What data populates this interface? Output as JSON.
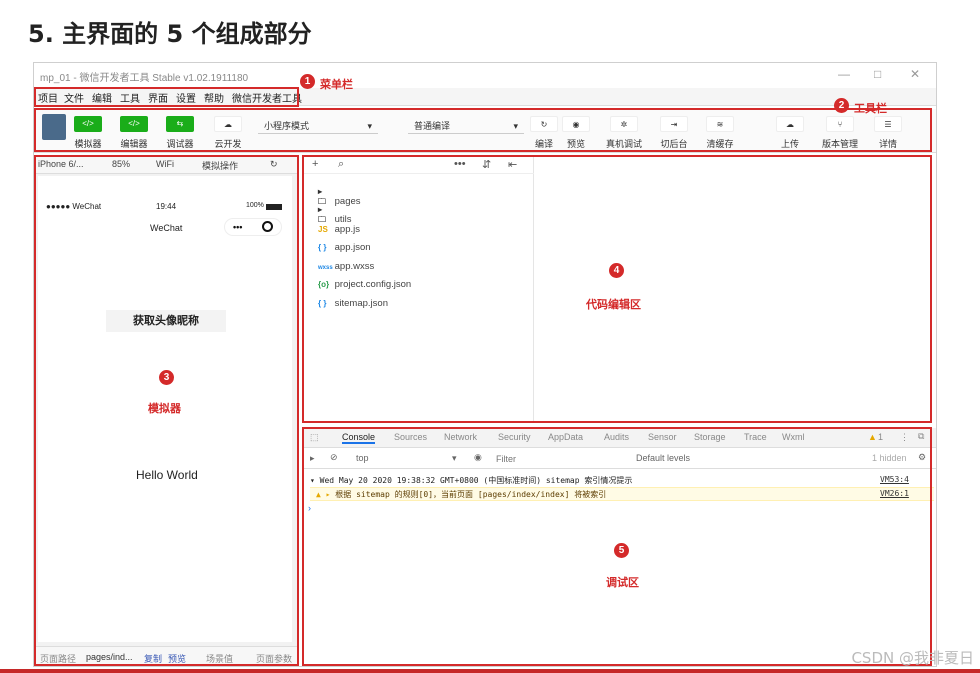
{
  "heading": "5. 主界面的 5 个组成部分",
  "window": {
    "title": "mp_01 - 微信开发者工具 Stable v1.02.1911180",
    "controls": [
      "—",
      "□",
      "✕"
    ]
  },
  "menu": [
    "项目",
    "文件",
    "编辑",
    "工具",
    "界面",
    "设置",
    "帮助",
    "微信开发者工具"
  ],
  "annotations": [
    {
      "num": "1",
      "label": "菜单栏"
    },
    {
      "num": "2",
      "label": "工具栏"
    },
    {
      "num": "3",
      "label": "模拟器"
    },
    {
      "num": "4",
      "label": "代码编辑区"
    },
    {
      "num": "5",
      "label": "调试区"
    }
  ],
  "toolbar": {
    "left_buttons": [
      {
        "icon": "</>",
        "label": "模拟器"
      },
      {
        "icon": "</>",
        "label": "编辑器"
      },
      {
        "icon": "⇆",
        "label": "调试器"
      },
      {
        "icon": "☁",
        "label": "云开发"
      }
    ],
    "mode_select": "小程序模式",
    "compile_select": "普通编译",
    "right_buttons": [
      {
        "icon": "↻",
        "label": "编译"
      },
      {
        "icon": "◉",
        "label": "预览"
      },
      {
        "icon": "✲",
        "label": "真机调试"
      },
      {
        "icon": "⇥",
        "label": "切后台"
      },
      {
        "icon": "≋",
        "label": "清缓存"
      },
      {
        "icon": "☁",
        "label": "上传"
      },
      {
        "icon": "⑂",
        "label": "版本管理"
      },
      {
        "icon": "☰",
        "label": "详情"
      }
    ]
  },
  "simulator": {
    "device": "iPhone 6/...",
    "zoom": "85%",
    "network": "WiFi",
    "ops": "模拟操作",
    "status_left": "●●●●● WeChat",
    "status_time": "19:44",
    "status_battery": "100%",
    "nav_title": "WeChat",
    "capsule": "•••",
    "button_text": "获取头像昵称",
    "content_text": "Hello World",
    "footer": {
      "path_label": "页面路径",
      "path": "pages/ind...",
      "copy": "复制",
      "preview": "预览",
      "scene": "场景值",
      "params": "页面参数"
    }
  },
  "files": [
    {
      "icon": "▸ 🗀",
      "name": "pages"
    },
    {
      "icon": "▸ 🗀",
      "name": "utils"
    },
    {
      "icon": "JS",
      "name": "app.js"
    },
    {
      "icon": "{ }",
      "name": "app.json"
    },
    {
      "icon": "wxss",
      "name": "app.wxss"
    },
    {
      "icon": "{o}",
      "name": "project.config.json"
    },
    {
      "icon": "{ }",
      "name": "sitemap.json"
    }
  ],
  "debug": {
    "tabs": [
      "Console",
      "Sources",
      "Network",
      "Security",
      "AppData",
      "Audits",
      "Sensor",
      "Storage",
      "Trace",
      "Wxml"
    ],
    "warn_count": "1",
    "context": "top",
    "filter_placeholder": "Filter",
    "levels": "Default levels",
    "hidden": "1 hidden",
    "log1": "Wed May 20 2020 19:38:32 GMT+0800 (中国标准时间) sitemap 索引情况提示",
    "log1_src": "VM53:4",
    "log2": "根据 sitemap 的规则[0]，当前页面 [pages/index/index] 将被索引",
    "log2_src": "VM26:1"
  },
  "watermark": "CSDN @我非夏日"
}
